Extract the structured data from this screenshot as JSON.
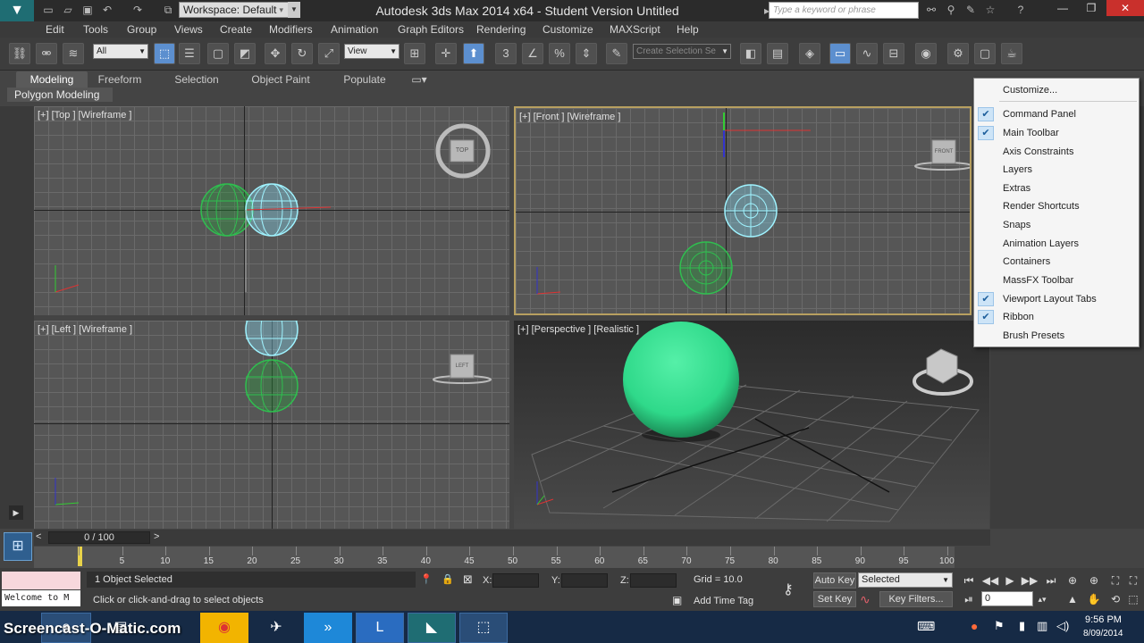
{
  "window": {
    "title": "Autodesk 3ds Max  2014 x64  -  Student Version    Untitled",
    "workspace": "Workspace: Default",
    "search_placeholder": "Type a keyword or phrase"
  },
  "menus": [
    "Edit",
    "Tools",
    "Group",
    "Views",
    "Create",
    "Modifiers",
    "Animation",
    "Graph Editors",
    "Rendering",
    "Customize",
    "MAXScript",
    "Help"
  ],
  "toolbar": {
    "selection_filter": "All",
    "ref_coord": "View",
    "snap_label": "3",
    "named_selection": "Create Selection Se"
  },
  "ribbon": {
    "tabs": [
      "Modeling",
      "Freeform",
      "Selection",
      "Object Paint",
      "Populate"
    ],
    "panel": "Polygon Modeling"
  },
  "viewports": {
    "top": "[+] [Top ] [Wireframe ]",
    "front": "[+] [Front ] [Wireframe ]",
    "left": "[+] [Left ] [Wireframe ]",
    "perspective": "[+] [Perspective ] [Realistic ]",
    "cube_top": "TOP",
    "cube_front": "FRONT",
    "cube_left": "LEFT"
  },
  "context_menu": {
    "items": [
      {
        "label": "Customize...",
        "checked": false
      },
      {
        "label": "Command Panel",
        "checked": true
      },
      {
        "label": "Main Toolbar",
        "checked": true
      },
      {
        "label": "Axis Constraints",
        "checked": false
      },
      {
        "label": "Layers",
        "checked": false
      },
      {
        "label": "Extras",
        "checked": false
      },
      {
        "label": "Render Shortcuts",
        "checked": false
      },
      {
        "label": "Snaps",
        "checked": false
      },
      {
        "label": "Animation Layers",
        "checked": false
      },
      {
        "label": "Containers",
        "checked": false
      },
      {
        "label": "MassFX Toolbar",
        "checked": false
      },
      {
        "label": "Viewport Layout Tabs",
        "checked": true
      },
      {
        "label": "Ribbon",
        "checked": true
      },
      {
        "label": "Brush Presets",
        "checked": false
      }
    ]
  },
  "timeline": {
    "frame": "0 / 100",
    "ticks": [
      "0",
      "5",
      "10",
      "15",
      "20",
      "25",
      "30",
      "35",
      "40",
      "45",
      "50",
      "55",
      "60",
      "65",
      "70",
      "75",
      "80",
      "85",
      "90",
      "95",
      "100"
    ]
  },
  "status": {
    "welcome": "Welcome to M",
    "selected": "1 Object Selected",
    "prompt": "Click or click-and-drag to select objects",
    "x_label": "X:",
    "y_label": "Y:",
    "z_label": "Z:",
    "grid": "Grid = 10.0",
    "add_time_tag": "Add Time Tag",
    "auto_key": "Auto Key",
    "set_key": "Set Key",
    "selected_dd": "Selected",
    "key_filters": "Key Filters...",
    "frame_field": "0"
  },
  "taskbar": {
    "watermark": "Screencast-O-Matic.com",
    "time": "9:56 PM",
    "date": "8/09/2014"
  },
  "colors": {
    "sphere_green": "#2fd98a",
    "wire_cyan": "#9ff3ff",
    "wire_green": "#2fbf4f",
    "close_red": "#c9302c"
  }
}
